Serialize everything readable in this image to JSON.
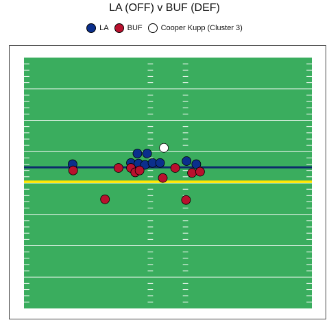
{
  "chart_data": {
    "type": "scatter",
    "title": "LA (OFF) v BUF (DEF)",
    "x_range": [
      0,
      53.3
    ],
    "y_range": [
      0,
      40
    ],
    "line_of_scrimmage": 22.5,
    "first_down_line": 20.2,
    "colors": {
      "field": "#3aad5e",
      "line_of_scrimmage": "#0c2a6b",
      "first_down": "#ffe600",
      "offense": "#0b2f8c",
      "defense": "#b9112e",
      "highlight": "#ffffff"
    },
    "series": [
      {
        "name": "LA",
        "points": [
          {
            "x": 9.0,
            "y": 23.0
          },
          {
            "x": 21.0,
            "y": 24.7
          },
          {
            "x": 22.8,
            "y": 24.7
          },
          {
            "x": 19.8,
            "y": 23.2
          },
          {
            "x": 21.2,
            "y": 23.1
          },
          {
            "x": 22.4,
            "y": 22.9
          },
          {
            "x": 23.8,
            "y": 23.2
          },
          {
            "x": 25.2,
            "y": 23.2
          },
          {
            "x": 30.1,
            "y": 23.5
          },
          {
            "x": 31.9,
            "y": 23.0
          }
        ]
      },
      {
        "name": "BUF",
        "points": [
          {
            "x": 9.1,
            "y": 22.0
          },
          {
            "x": 17.5,
            "y": 22.4
          },
          {
            "x": 19.8,
            "y": 22.4
          },
          {
            "x": 20.6,
            "y": 21.7
          },
          {
            "x": 21.4,
            "y": 22.0
          },
          {
            "x": 25.7,
            "y": 20.8
          },
          {
            "x": 28.0,
            "y": 22.4
          },
          {
            "x": 31.1,
            "y": 21.6
          },
          {
            "x": 32.6,
            "y": 21.8
          },
          {
            "x": 15.0,
            "y": 17.4
          },
          {
            "x": 30.0,
            "y": 17.3
          }
        ]
      },
      {
        "name": "Cooper Kupp (Cluster 3)",
        "points": [
          {
            "x": 25.9,
            "y": 25.6
          }
        ]
      }
    ]
  }
}
